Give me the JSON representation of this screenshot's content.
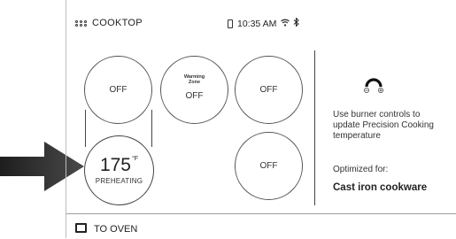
{
  "header": {
    "app_title": "COOKTOP",
    "time": "10:35 AM",
    "icons": [
      "phone-icon",
      "wifi-icon",
      "bluetooth-icon"
    ]
  },
  "burners": {
    "top_left": {
      "state": "OFF"
    },
    "top_middle": {
      "zone_label": "Warming Zone",
      "state": "OFF"
    },
    "top_right": {
      "state": "OFF"
    },
    "bottom_right": {
      "state": "OFF"
    },
    "bottom_left": {
      "temperature": "175",
      "unit": "°F",
      "status": "PREHEATING"
    }
  },
  "info_panel": {
    "knob_icon": "burner-knob-icon",
    "instructions": "Use burner controls to update Precision Cooking temperature",
    "optimized_label": "Optimized for:",
    "optimized_value": "Cast iron cookware"
  },
  "footer": {
    "oven_label": "TO OVEN"
  },
  "colors": {
    "arrow": "#3a3a3a",
    "border": "#555555",
    "text": "#222222"
  }
}
